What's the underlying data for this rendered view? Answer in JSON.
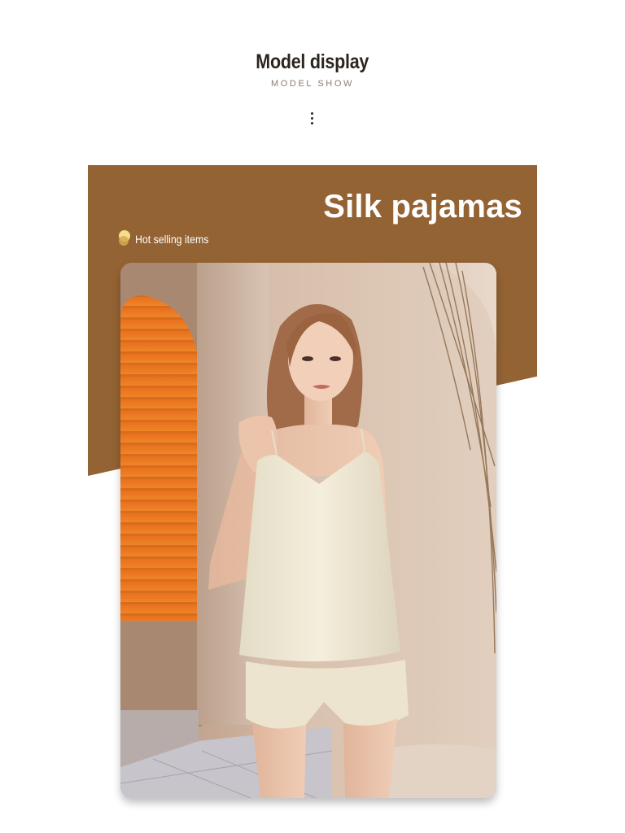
{
  "section": {
    "title": "Model display",
    "subtitle": "MODEL SHOW"
  },
  "banner": {
    "title": "Silk pajamas",
    "tag": "Hot selling items",
    "band_color": "#946334"
  },
  "icons": {
    "dots": "vertical-dots-icon",
    "tag_bullet": "gold-dot-icon"
  },
  "photo": {
    "subject": "model in cream silk camisole and shorts"
  }
}
